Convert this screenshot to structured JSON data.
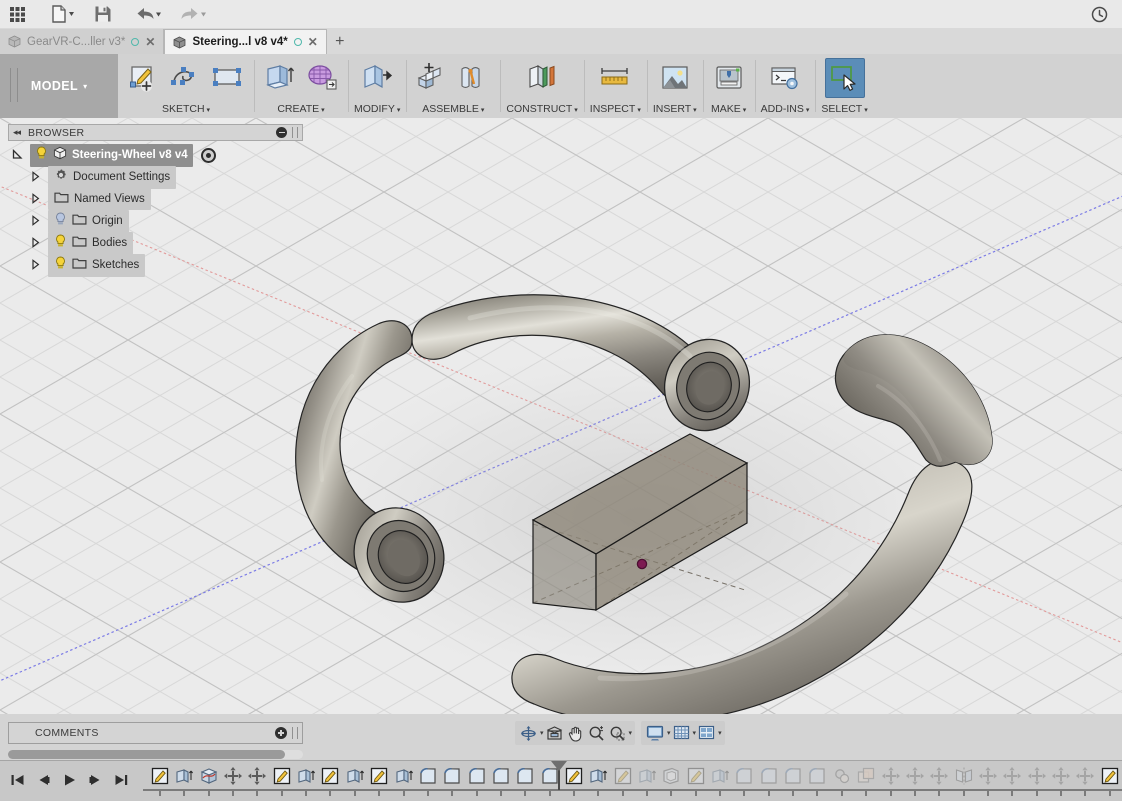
{
  "quick_access": {
    "buttons": [
      {
        "name": "app-grid-button",
        "icon": "grid-apps-icon",
        "label": "Show Data Panel"
      },
      {
        "name": "file-menu-button",
        "icon": "file-icon",
        "label": "File"
      },
      {
        "name": "save-button",
        "icon": "save-floppy-icon",
        "label": "Save"
      },
      {
        "name": "undo-button",
        "icon": "undo-arrow-icon",
        "label": "Undo"
      },
      {
        "name": "redo-button",
        "icon": "redo-arrow-icon",
        "label": "Redo"
      }
    ],
    "history_button": {
      "name": "job-status-clock-button",
      "icon": "clock-icon",
      "label": "Job Status"
    }
  },
  "tabs": [
    {
      "title": "GearVR-C...ller v3*",
      "active": false,
      "icon": "cube-icon",
      "save_dot": "unsaved-dot-icon",
      "close": "✕"
    },
    {
      "title": "Steering...l v8 v4*",
      "active": true,
      "icon": "cube-icon",
      "save_dot": "unsaved-dot-icon",
      "close": "✕"
    }
  ],
  "tab_add_label": "+",
  "workspace": {
    "label": "MODEL",
    "caret": "▾"
  },
  "toolbar_panels": [
    {
      "label": "SKETCH",
      "caret": "▾",
      "buttons": [
        {
          "name": "create-sketch-button",
          "icon": "sketch-pencil-icon",
          "selected": false
        },
        {
          "name": "sketch-spline-button",
          "icon": "spline-curve-icon",
          "selected": false
        },
        {
          "name": "sketch-rectangle-button",
          "icon": "rectangle-icon",
          "selected": false
        }
      ]
    },
    {
      "label": "CREATE",
      "caret": "▾",
      "buttons": [
        {
          "name": "extrude-button",
          "icon": "extrude-box-icon",
          "selected": false
        },
        {
          "name": "create-form-button",
          "icon": "tspline-form-icon",
          "selected": false
        }
      ]
    },
    {
      "label": "MODIFY",
      "caret": "▾",
      "buttons": [
        {
          "name": "press-pull-button",
          "icon": "press-pull-icon",
          "selected": false
        }
      ]
    },
    {
      "label": "ASSEMBLE",
      "caret": "▾",
      "buttons": [
        {
          "name": "new-component-button",
          "icon": "new-component-icon",
          "selected": false
        },
        {
          "name": "joint-button",
          "icon": "joint-icon",
          "selected": false
        }
      ]
    },
    {
      "label": "CONSTRUCT",
      "caret": "▾",
      "buttons": [
        {
          "name": "construct-plane-button",
          "icon": "offset-plane-icon",
          "selected": false
        }
      ]
    },
    {
      "label": "INSPECT",
      "caret": "▾",
      "buttons": [
        {
          "name": "measure-button",
          "icon": "ruler-measure-icon",
          "selected": false
        }
      ]
    },
    {
      "label": "INSERT",
      "caret": "▾",
      "buttons": [
        {
          "name": "insert-mcmaster-button",
          "icon": "picture-mountain-icon",
          "selected": false
        }
      ]
    },
    {
      "label": "MAKE",
      "caret": "▾",
      "buttons": [
        {
          "name": "3d-print-button",
          "icon": "3d-printer-icon",
          "selected": false
        }
      ]
    },
    {
      "label": "ADD-INS",
      "caret": "▾",
      "buttons": [
        {
          "name": "scripts-addins-button",
          "icon": "script-console-icon",
          "selected": false
        }
      ]
    },
    {
      "label": "SELECT",
      "caret": "▾",
      "buttons": [
        {
          "name": "select-tool-button",
          "icon": "select-arrow-icon",
          "selected": true
        }
      ]
    }
  ],
  "browser": {
    "header": {
      "title": "BROWSER",
      "collapse_arrows": "◂◂",
      "minimize": "minimize-icon",
      "grip": "panel-grip"
    },
    "root": {
      "label": "Steering-Wheel v8 v4",
      "expanded": true,
      "bulb": "on",
      "icon": "component-cube-icon",
      "activate": "activate-radio-icon"
    },
    "items": [
      {
        "label": "Document Settings",
        "icon": "gear-icon",
        "bulb": "none",
        "expanded": false
      },
      {
        "label": "Named Views",
        "icon": "folder-icon",
        "bulb": "none",
        "expanded": false
      },
      {
        "label": "Origin",
        "icon": "folder-icon",
        "bulb": "off",
        "expanded": false
      },
      {
        "label": "Bodies",
        "icon": "folder-icon",
        "bulb": "on",
        "expanded": false
      },
      {
        "label": "Sketches",
        "icon": "folder-icon",
        "bulb": "on",
        "expanded": false
      }
    ]
  },
  "comments": {
    "title": "COMMENTS",
    "add": "add-comment-icon",
    "grip": "panel-grip"
  },
  "navigation_bar": [
    {
      "name": "orbit-button",
      "icon": "orbit-icon",
      "caret": "▾"
    },
    {
      "name": "look-at-button",
      "icon": "look-at-icon",
      "caret": ""
    },
    {
      "name": "pan-button",
      "icon": "pan-hand-icon",
      "caret": ""
    },
    {
      "name": "zoom-button",
      "icon": "zoom-magnifier-icon",
      "caret": ""
    },
    {
      "name": "fit-button",
      "icon": "zoom-fit-icon",
      "caret": "▾"
    },
    {
      "name": "display-settings-button",
      "icon": "monitor-display-icon",
      "caret": "▾"
    },
    {
      "name": "grid-snaps-button",
      "icon": "grid-icon",
      "caret": "▾"
    },
    {
      "name": "viewports-button",
      "icon": "viewports-icon",
      "caret": "▾"
    }
  ],
  "timeline": {
    "playback": [
      {
        "name": "go-to-beginning-button",
        "icon": "skip-start-icon"
      },
      {
        "name": "step-back-button",
        "icon": "step-back-icon"
      },
      {
        "name": "play-button",
        "icon": "play-icon"
      },
      {
        "name": "step-forward-button",
        "icon": "step-forward-icon"
      },
      {
        "name": "go-to-end-button",
        "icon": "skip-end-icon"
      }
    ],
    "marker_index": 16,
    "features": [
      {
        "icon": "sketch-icon",
        "rolled_back": false
      },
      {
        "icon": "extrude-icon",
        "rolled_back": false
      },
      {
        "icon": "sweep-icon",
        "rolled_back": false
      },
      {
        "icon": "move-icon",
        "rolled_back": false
      },
      {
        "icon": "move-icon",
        "rolled_back": false
      },
      {
        "icon": "sketch-icon",
        "rolled_back": false
      },
      {
        "icon": "extrude-icon",
        "rolled_back": false
      },
      {
        "icon": "sketch-icon",
        "rolled_back": false
      },
      {
        "icon": "extrude-icon",
        "rolled_back": false
      },
      {
        "icon": "sketch-icon",
        "rolled_back": false
      },
      {
        "icon": "extrude-icon",
        "rolled_back": false
      },
      {
        "icon": "fillet-icon",
        "rolled_back": false
      },
      {
        "icon": "fillet-icon",
        "rolled_back": false
      },
      {
        "icon": "fillet-icon",
        "rolled_back": false
      },
      {
        "icon": "fillet-icon",
        "rolled_back": false
      },
      {
        "icon": "fillet-icon",
        "rolled_back": false
      },
      {
        "icon": "fillet-icon",
        "rolled_back": false
      },
      {
        "icon": "sketch-icon",
        "rolled_back": false
      },
      {
        "icon": "extrude-icon",
        "rolled_back": false
      },
      {
        "icon": "sketch-icon",
        "rolled_back": true
      },
      {
        "icon": "extrude-icon",
        "rolled_back": true
      },
      {
        "icon": "shell-icon",
        "rolled_back": true
      },
      {
        "icon": "sketch-icon",
        "rolled_back": true
      },
      {
        "icon": "extrude-icon",
        "rolled_back": true
      },
      {
        "icon": "fillet-icon",
        "rolled_back": true
      },
      {
        "icon": "fillet-icon",
        "rolled_back": true
      },
      {
        "icon": "fillet-icon",
        "rolled_back": true
      },
      {
        "icon": "fillet-icon",
        "rolled_back": true
      },
      {
        "icon": "thread-icon",
        "rolled_back": true
      },
      {
        "icon": "combine-icon",
        "rolled_back": true
      },
      {
        "icon": "move-icon",
        "rolled_back": true
      },
      {
        "icon": "move-icon",
        "rolled_back": true
      },
      {
        "icon": "move-icon",
        "rolled_back": true
      },
      {
        "icon": "mirror-icon",
        "rolled_back": true
      },
      {
        "icon": "move-icon",
        "rolled_back": true
      },
      {
        "icon": "move-icon",
        "rolled_back": true
      },
      {
        "icon": "move-icon",
        "rolled_back": true
      },
      {
        "icon": "move-icon",
        "rolled_back": true
      },
      {
        "icon": "move-icon",
        "rolled_back": true
      },
      {
        "icon": "sketch-icon",
        "rolled_back": false
      }
    ]
  },
  "viewport": {
    "background_color": "#ebebeb",
    "grid_color": "#c7c7c7",
    "axis_x_color": "#e08a8a",
    "axis_y_color": "#7b7be0",
    "body_color": "#8a8276",
    "box_color": "#8d8573",
    "origin_point_color": "#8a1f5a",
    "bodies": [
      {
        "name": "steering-wheel-torus",
        "type": "open-torus",
        "description": "C-shaped torus ring with bored tube ends"
      },
      {
        "name": "hub-box",
        "type": "rectangular-prism",
        "description": "Translucent rectangular block at center with construction diagonals and origin point"
      }
    ]
  }
}
